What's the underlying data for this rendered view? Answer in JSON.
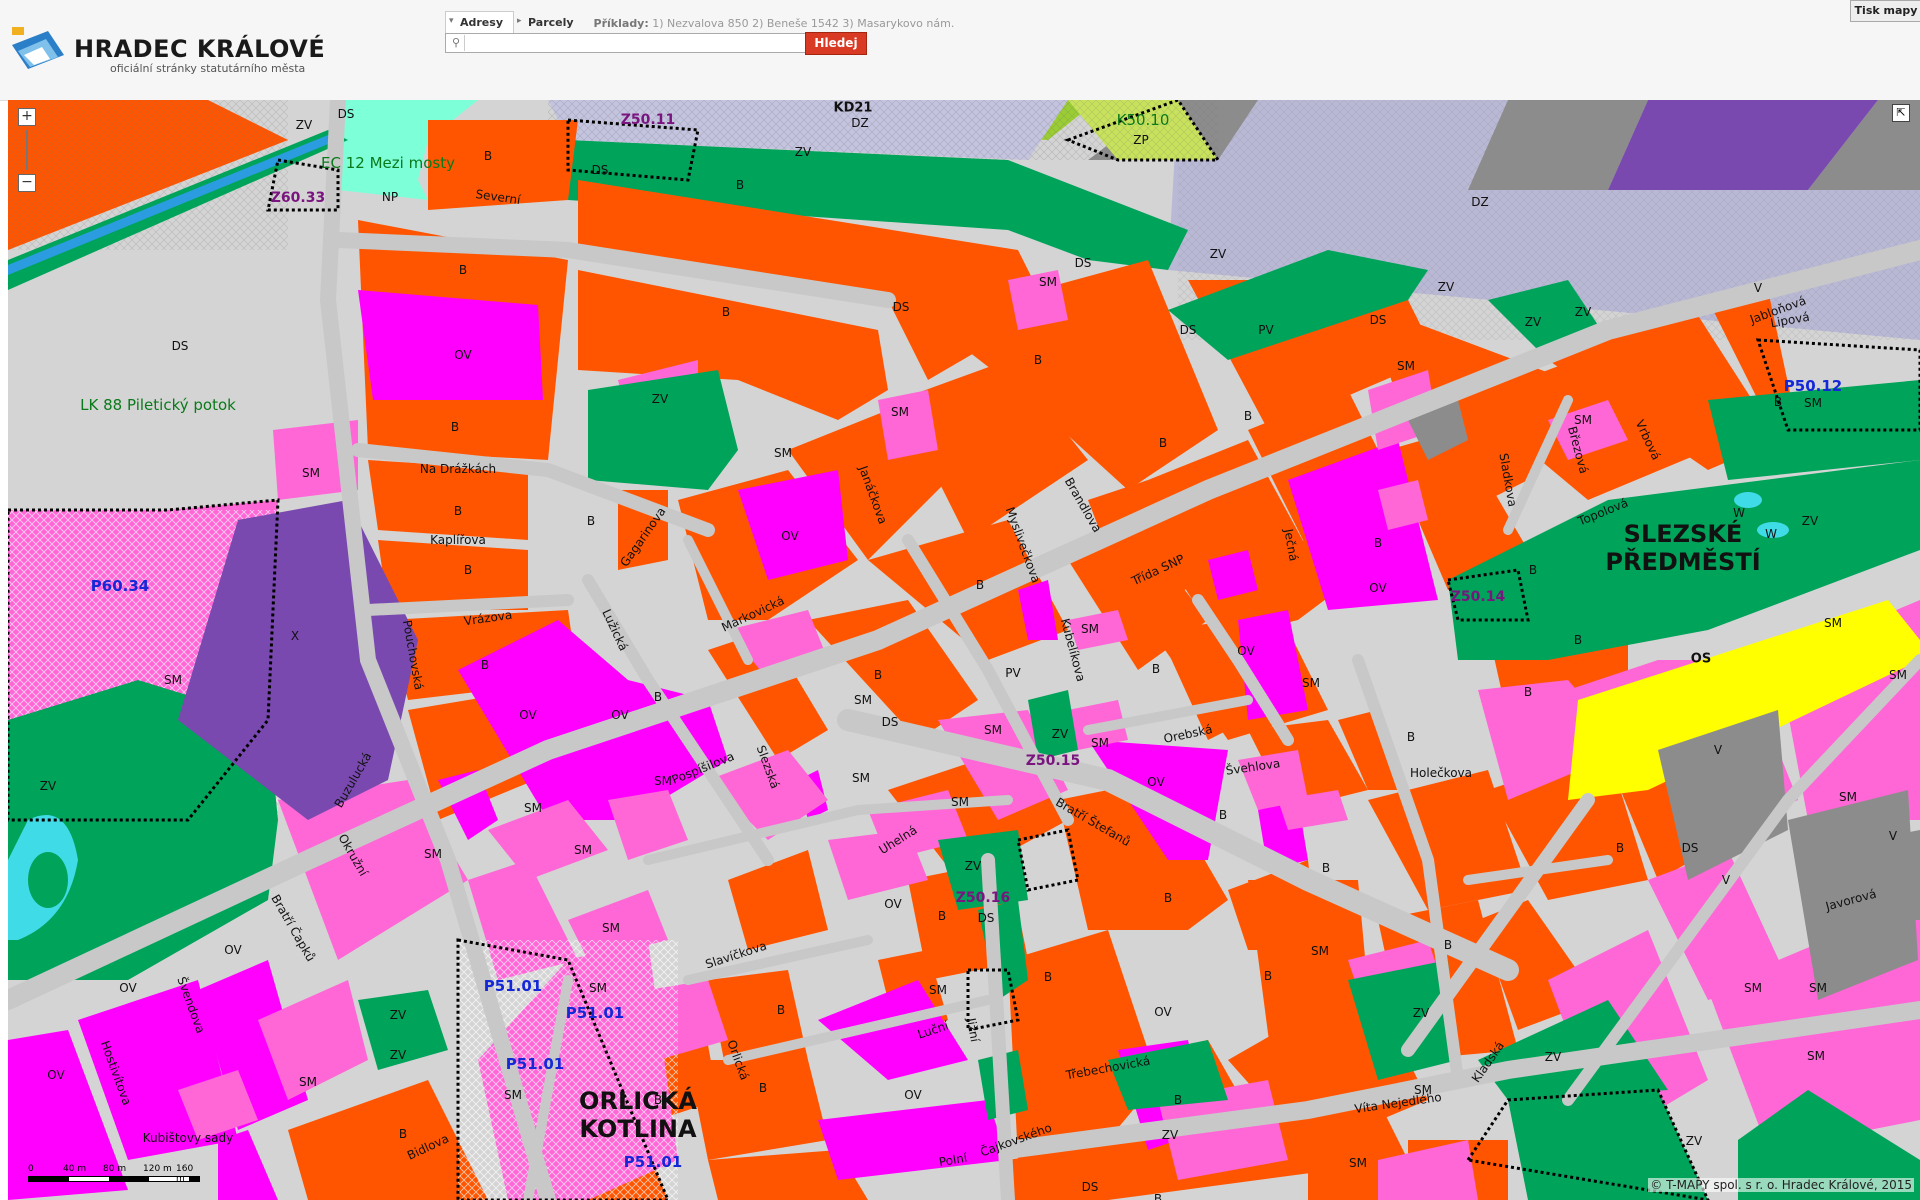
{
  "header": {
    "logo_title": "HRADEC KRÁLOVÉ",
    "logo_subtitle": "oficiální stránky statutárního města",
    "tabs": [
      {
        "label": "Adresy"
      },
      {
        "label": "Parcely"
      }
    ],
    "examples_label": "Příklady:",
    "examples": "1) Nezvalova 850   2) Beneše 1542   3) Masarykovo nám.",
    "search_placeholder": "",
    "search_button": "Hledej",
    "print_button": "Tisk mapy"
  },
  "map": {
    "colors": {
      "orange_B": "#ff5500",
      "magenta_OV": "#ff00ff",
      "pink_SM": "#ff66d6",
      "green_ZV": "#00a35a",
      "grey_DS": "#d4d4d4",
      "yellow_OS": "#ffff00",
      "grey_V": "#8c8c8c",
      "purple_X": "#7a49b0",
      "lavender_DZ": "#b9b9d6",
      "cyan_W": "#3fdbe6",
      "road": "#c8c8c8"
    },
    "districts": [
      {
        "line1": "SLEZSKÉ",
        "line2": "PŘEDMĚSTÍ"
      },
      {
        "line1": "ORLICKÁ",
        "line2": "KOTLINA"
      }
    ],
    "green_labels": [
      "LK 88 Piletický potok",
      "EC 12 Mezi mosty",
      "K50.10"
    ],
    "zone_labels": [
      "P60.34",
      "P51.01",
      "P51.01",
      "P51.01",
      "P51.01",
      "P50.12"
    ],
    "project_labels": [
      "Z50.11",
      "Z60.33",
      "Z50.14",
      "Z50.16",
      "Z50.15"
    ],
    "codes": [
      "B",
      "OV",
      "SM",
      "ZV",
      "DS",
      "DZ",
      "OS",
      "V",
      "X",
      "W",
      "PV",
      "NP",
      "ZP",
      "KD21"
    ],
    "streets": [
      "Severní",
      "Na Drážkách",
      "Kaplířova",
      "Vrázova",
      "Pouchovská",
      "Buzulucká",
      "Okružní",
      "Pospíšilova",
      "Gagarinova",
      "Slezská",
      "Lužická",
      "Markovická",
      "Janáčkova",
      "Myslivečkova",
      "Brandlova",
      "Třída SNP",
      "Ječná",
      "Kubelíkova",
      "Orebská",
      "Švehlova",
      "Holečkova",
      "Bratří Štefanů",
      "Uhelná",
      "Slavíčkova",
      "Luční",
      "Jižní",
      "Třebechovická",
      "Víta Nejedlého",
      "Kladská",
      "Topolová",
      "Sladkova",
      "Březová",
      "Vrbová",
      "Jabloňová",
      "Lipová",
      "Javorová",
      "Bratří Čapků",
      "Švendova",
      "Hostivítova",
      "Kubištovy sady",
      "Bidlova",
      "Čajkovského",
      "Polní",
      "Orlická"
    ],
    "scale": {
      "ticks": [
        "0",
        "40 m",
        "80 m",
        "120 m",
        "160 m"
      ]
    },
    "copyright": "© T-MAPY spol. s r. o. Hradec Králové, 2015"
  }
}
